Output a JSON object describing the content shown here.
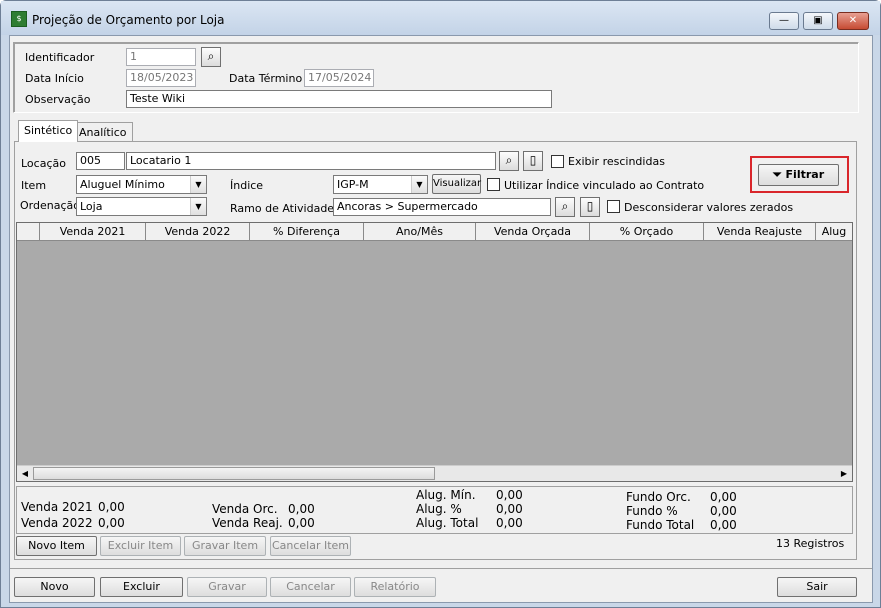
{
  "window": {
    "title": "Projeção de Orçamento por Loja",
    "icon": "app-icon"
  },
  "header": {
    "identificador_label": "Identificador",
    "identificador_value": "1",
    "data_inicio_label": "Data Início",
    "data_inicio_value": "18/05/2023",
    "data_termino_label": "Data Término",
    "data_termino_value": "17/05/2024",
    "observacao_label": "Observação",
    "observacao_value": "Teste Wiki"
  },
  "tabs": [
    {
      "label": "Sintético",
      "active": true
    },
    {
      "label": "Analítico",
      "active": false
    }
  ],
  "filters": {
    "locacao_label": "Locação",
    "locacao_code": "005",
    "locacao_name": "Locatario 1",
    "exibir_rescindidas": "Exibir rescindidas",
    "item_label": "Item",
    "item_value": "Aluguel Mínimo",
    "indice_label": "Índice",
    "indice_value": "IGP-M",
    "visualizar": "Visualizar",
    "utilizar_indice": "Utilizar Índice vinculado ao Contrato",
    "ordenacao_label": "Ordenação",
    "ordenacao_value": "Loja",
    "ramo_label": "Ramo de Atividade",
    "ramo_value": "Ancoras > Supermercado",
    "desconsiderar": "Desconsiderar valores zerados",
    "filtrar": "Filtrar"
  },
  "grid": {
    "columns": [
      "",
      "Venda 2021",
      "Venda 2022",
      "% Diferença",
      "Ano/Mês",
      "Venda Orçada",
      "% Orçado",
      "Venda Reajuste",
      "Alug"
    ]
  },
  "summary": {
    "venda2021_label": "Venda 2021",
    "venda2021_value": "0,00",
    "venda2022_label": "Venda 2022",
    "venda2022_value": "0,00",
    "vendaorc_label": "Venda Orc.",
    "vendaorc_value": "0,00",
    "vendareaj_label": "Venda Reaj.",
    "vendareaj_value": "0,00",
    "alugmin_label": "Alug. Mín.",
    "alugmin_value": "0,00",
    "alugpct_label": "Alug. %",
    "alugpct_value": "0,00",
    "alugtotal_label": "Alug. Total",
    "alugtotal_value": "0,00",
    "fundoorc_label": "Fundo Orc.",
    "fundoorc_value": "0,00",
    "fundopct_label": "Fundo %",
    "fundopct_value": "0,00",
    "fundototal_label": "Fundo Total",
    "fundototal_value": "0,00"
  },
  "item_buttons": {
    "novo": "Novo Item",
    "excluir": "Excluir Item",
    "gravar": "Gravar Item",
    "cancelar": "Cancelar Item"
  },
  "registros": "13 Registros",
  "footer": {
    "novo": "Novo",
    "excluir": "Excluir",
    "gravar": "Gravar",
    "cancelar": "Cancelar",
    "relatorio": "Relatório",
    "sair": "Sair"
  },
  "colors": {
    "highlight_border": "#d9262b",
    "grid_bg": "#aaaaaa"
  }
}
